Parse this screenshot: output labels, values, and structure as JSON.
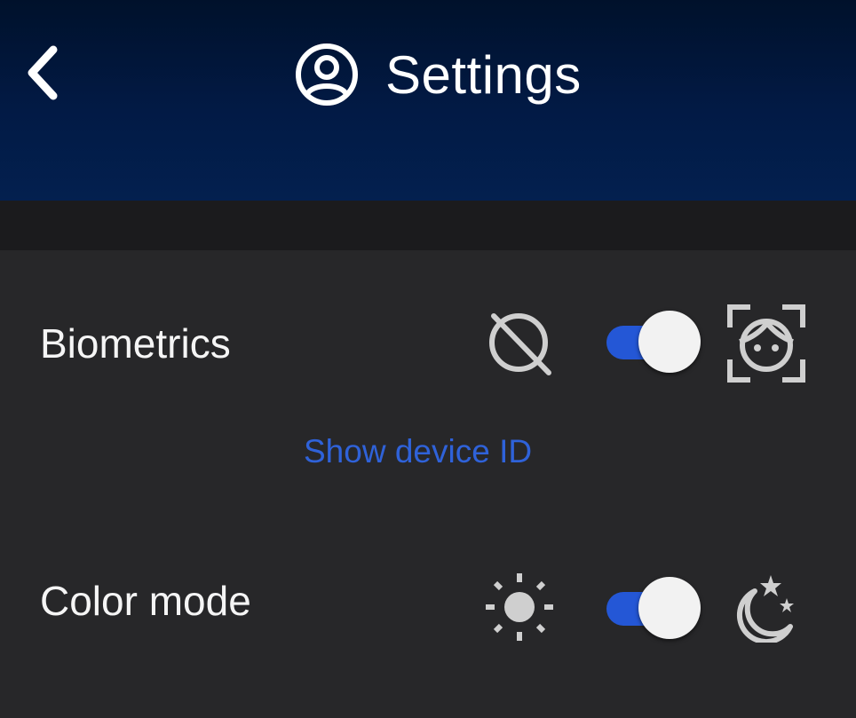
{
  "header": {
    "back_icon": "chevron-left-icon",
    "title_icon": "account-circle-icon",
    "title": "Settings"
  },
  "biometrics": {
    "label": "Biometrics",
    "off_icon": "biometrics-off-icon",
    "on_icon": "face-scan-icon",
    "enabled": true,
    "link": "Show device ID"
  },
  "color_mode": {
    "label": "Color mode",
    "light_icon": "sun-icon",
    "dark_icon": "moon-stars-icon",
    "dark_enabled": true
  },
  "colors": {
    "accent": "#2f62d9",
    "toggle_track": "#2457d6",
    "knob": "#f2f2f2",
    "icon": "#cfcfcf",
    "background": "#272729",
    "header": "#021a45"
  }
}
